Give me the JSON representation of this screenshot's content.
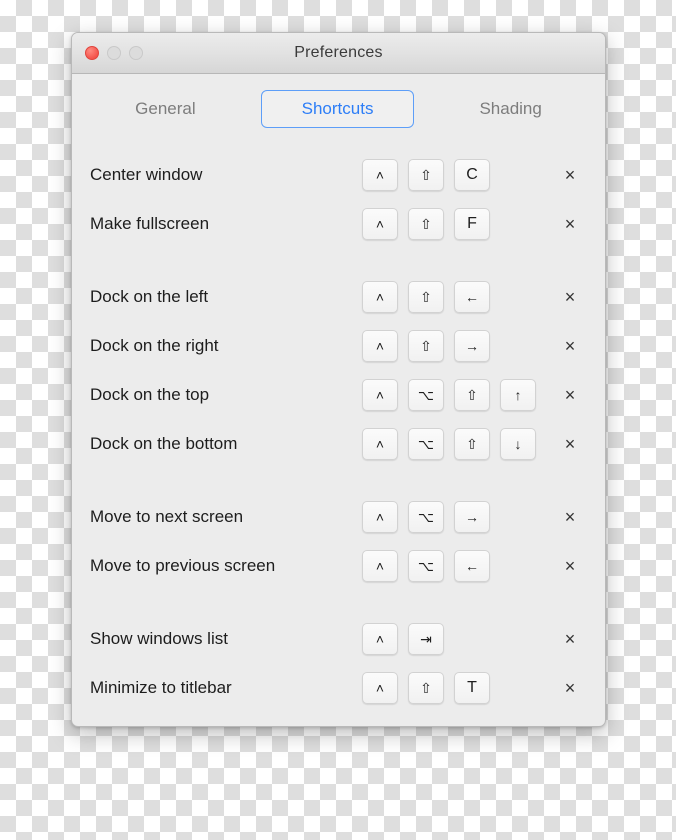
{
  "window": {
    "title": "Preferences",
    "traffic_lights": [
      {
        "name": "close",
        "color": "#f4544c",
        "enabled": true
      },
      {
        "name": "minimize",
        "color": "#dcdcdc",
        "enabled": false
      },
      {
        "name": "zoom",
        "color": "#dcdcdc",
        "enabled": false
      }
    ]
  },
  "tabs": [
    {
      "label": "General",
      "active": false
    },
    {
      "label": "Shortcuts",
      "active": true
    },
    {
      "label": "Shading",
      "active": false
    }
  ],
  "colors": {
    "accent": "#2d7ef7",
    "accent_border": "#5d9ef8",
    "inactive_tab_text": "#7d7d7d",
    "window_background": "#ececec",
    "titlebar_top": "#ececec",
    "titlebar_bottom": "#d6d6d6",
    "key_face": "#f7f7f7",
    "key_border": "#d2d2d2",
    "label_text": "#1d1d1d",
    "close_button": "#f4544c"
  },
  "delete_icon": "×",
  "shortcuts": [
    {
      "label": "Center window",
      "keys": [
        "˄",
        "⇧",
        "C"
      ],
      "key_names": [
        "control-key",
        "shift-key",
        "letter-c-key"
      ],
      "gap_before": false
    },
    {
      "label": "Make fullscreen",
      "keys": [
        "˄",
        "⇧",
        "F"
      ],
      "key_names": [
        "control-key",
        "shift-key",
        "letter-f-key"
      ],
      "gap_before": false
    },
    {
      "label": "Dock on the left",
      "keys": [
        "˄",
        "⇧",
        "←"
      ],
      "key_names": [
        "control-key",
        "shift-key",
        "arrow-left-key"
      ],
      "gap_before": true
    },
    {
      "label": "Dock on the right",
      "keys": [
        "˄",
        "⇧",
        "→"
      ],
      "key_names": [
        "control-key",
        "shift-key",
        "arrow-right-key"
      ],
      "gap_before": false
    },
    {
      "label": "Dock on the top",
      "keys": [
        "˄",
        "⌥",
        "⇧",
        "↑"
      ],
      "key_names": [
        "control-key",
        "option-key",
        "shift-key",
        "arrow-up-key"
      ],
      "gap_before": false
    },
    {
      "label": "Dock on the bottom",
      "keys": [
        "˄",
        "⌥",
        "⇧",
        "↓"
      ],
      "key_names": [
        "control-key",
        "option-key",
        "shift-key",
        "arrow-down-key"
      ],
      "gap_before": false
    },
    {
      "label": "Move to next screen",
      "keys": [
        "˄",
        "⌥",
        "→"
      ],
      "key_names": [
        "control-key",
        "option-key",
        "arrow-right-key"
      ],
      "gap_before": true
    },
    {
      "label": "Move to previous screen",
      "keys": [
        "˄",
        "⌥",
        "←"
      ],
      "key_names": [
        "control-key",
        "option-key",
        "arrow-left-key"
      ],
      "gap_before": false
    },
    {
      "label": "Show windows list",
      "keys": [
        "˄",
        "⇥"
      ],
      "key_names": [
        "control-key",
        "tab-key"
      ],
      "gap_before": true
    },
    {
      "label": "Minimize to titlebar",
      "keys": [
        "˄",
        "⇧",
        "T"
      ],
      "key_names": [
        "control-key",
        "shift-key",
        "letter-t-key"
      ],
      "gap_before": false
    }
  ]
}
